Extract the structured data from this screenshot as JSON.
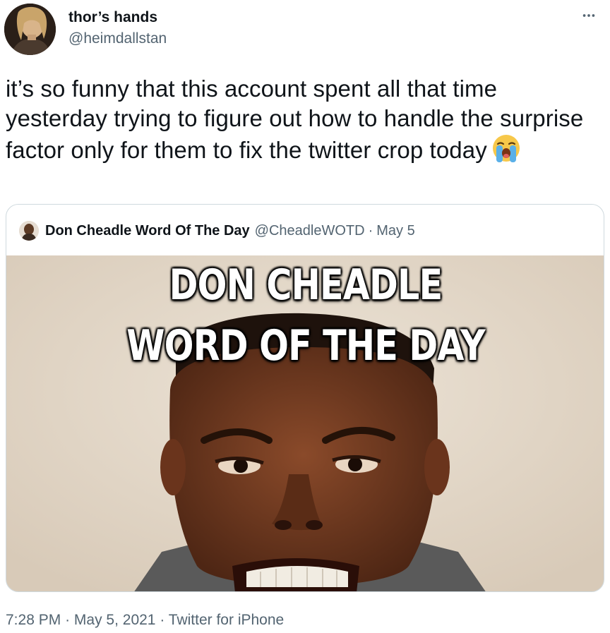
{
  "author": {
    "display_name": "thor’s hands",
    "handle": "@heimdallstan"
  },
  "tweet": {
    "text": "it’s so funny that this account spent all that time yesterday trying to figure out how to handle the surprise factor only for them to fix the twitter crop today",
    "emoji": "loudly-crying-face"
  },
  "quoted_tweet": {
    "display_name": "Don Cheadle Word Of The Day",
    "handle": "@CheadleWOTD",
    "separator": "·",
    "date": "May 5",
    "media": {
      "caption_line_1": "DON CHEADLE",
      "caption_line_2": "WORD OF THE DAY"
    }
  },
  "footer": {
    "time": "7:28 PM",
    "separator_1": "·",
    "date": "May 5, 2021",
    "separator_2": "·",
    "source": "Twitter for iPhone"
  },
  "icons": {
    "more": "more-horizontal-icon"
  },
  "colors": {
    "text_primary": "#0f1419",
    "text_secondary": "#536471",
    "border": "#cfd9de"
  }
}
